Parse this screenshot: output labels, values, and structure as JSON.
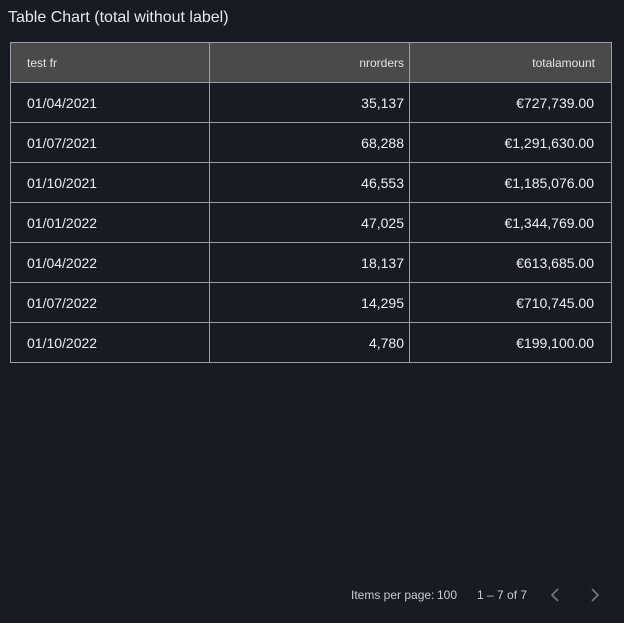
{
  "title": "Table Chart (total without label)",
  "table": {
    "columns": [
      "test fr",
      "nrorders",
      "totalamount"
    ],
    "rows": [
      [
        "01/04/2021",
        "35,137",
        "€727,739.00"
      ],
      [
        "01/07/2021",
        "68,288",
        "€1,291,630.00"
      ],
      [
        "01/10/2021",
        "46,553",
        "€1,185,076.00"
      ],
      [
        "01/01/2022",
        "47,025",
        "€1,344,769.00"
      ],
      [
        "01/04/2022",
        "18,137",
        "€613,685.00"
      ],
      [
        "01/07/2022",
        "14,295",
        "€710,745.00"
      ],
      [
        "01/10/2022",
        "4,780",
        "€199,100.00"
      ]
    ]
  },
  "paginator": {
    "items_per_page_label": "Items per page:",
    "page_size": "100",
    "range_label": "1 – 7 of 7",
    "prev_icon": "chevron-left-icon",
    "next_icon": "chevron-right-icon"
  },
  "colors": {
    "background": "#181c22",
    "header_background": "#4a4a4a",
    "border": "#9a9ea4",
    "text": "#e8eaed"
  }
}
